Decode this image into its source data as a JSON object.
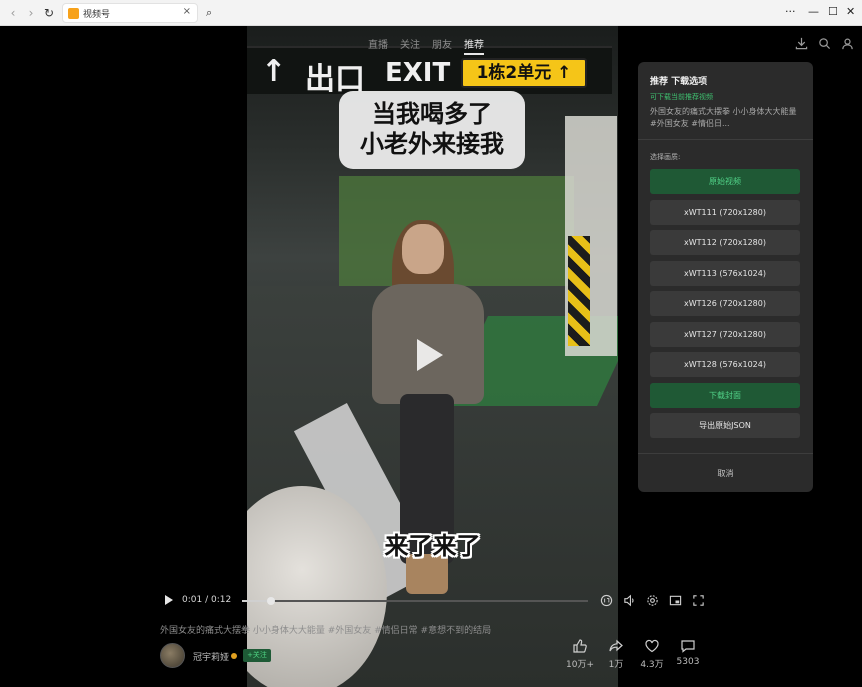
{
  "browser": {
    "tab_title": "视频号",
    "tab_close": "×",
    "back": "‹",
    "forward": "›",
    "reload": "↻",
    "search_icon": "⌕",
    "menu": "···",
    "minimize": "—",
    "maximize": "☐",
    "close": "✕"
  },
  "top_tabs": [
    {
      "label": "直播"
    },
    {
      "label": "关注"
    },
    {
      "label": "朋友"
    },
    {
      "label": "推荐"
    }
  ],
  "video": {
    "sign_arrow": "↑",
    "sign_cn": "出口",
    "sign_en": "EXIT",
    "sign_unit": "1栋2单元 ↑",
    "caption_line1": "当我喝多了",
    "caption_line2": "小老外来接我",
    "subtitle": "来了来了"
  },
  "player": {
    "time": "0:01 / 0:12",
    "progress": 0.083
  },
  "post": {
    "description": "外国女友的痛式大摆拳 小小身体大大能量 #外国女友 #情侣日常 #意想不到的结局",
    "author": "冠宇莉娅",
    "follow_label": "+关注"
  },
  "stats": [
    {
      "icon": "thumb-up-icon",
      "value": "10万+"
    },
    {
      "icon": "share-icon",
      "value": "1万"
    },
    {
      "icon": "heart-icon",
      "value": "4.3万"
    },
    {
      "icon": "comment-icon",
      "value": "5303"
    }
  ],
  "panel": {
    "title": "推荐 下载选项",
    "hint": "可下载当前推荐视频",
    "desc": "外国女友的痛式大摆拳 小小身体大大能量 #外国女友 #情侣日...",
    "quality_label": "选择画质:",
    "options": [
      {
        "label": "原始视频",
        "primary": true
      },
      {
        "label": "xWT111 (720x1280)",
        "primary": false
      },
      {
        "label": "xWT112 (720x1280)",
        "primary": false
      },
      {
        "label": "xWT113 (576x1024)",
        "primary": false
      },
      {
        "label": "xWT126 (720x1280)",
        "primary": false
      },
      {
        "label": "xWT127 (720x1280)",
        "primary": false
      },
      {
        "label": "xWT128 (576x1024)",
        "primary": false
      },
      {
        "label": "下载封面",
        "primary": true
      },
      {
        "label": "导出原始JSON",
        "primary": false
      }
    ],
    "cancel": "取消"
  }
}
